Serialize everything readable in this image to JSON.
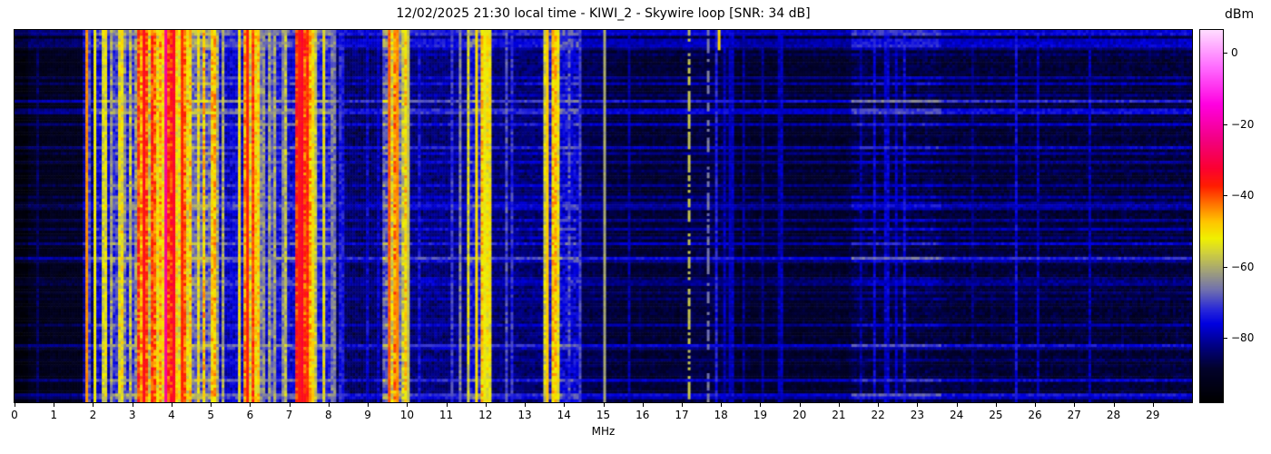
{
  "title": "12/02/2025 21:30 local time - KIWI_2 - Skywire loop [SNR: 34 dB]",
  "station": "KIWI_2",
  "antenna": "Skywire loop",
  "snr_label": "SNR: 34 dB",
  "datetime_local": "12/02/2025 21:30",
  "chart_data": {
    "type": "heatmap",
    "subtype": "radio-spectrum-waterfall",
    "title": "12/02/2025 21:30 local time - KIWI_2 - Skywire loop [SNR: 34 dB]",
    "xlabel": "MHz",
    "x_range": [
      0,
      30
    ],
    "x_tick_values": [
      0,
      1,
      2,
      3,
      4,
      5,
      6,
      7,
      8,
      9,
      10,
      11,
      12,
      13,
      14,
      15,
      16,
      17,
      18,
      19,
      20,
      21,
      22,
      23,
      24,
      25,
      26,
      27,
      28,
      29
    ],
    "y_axis": {
      "type": "time",
      "tick_labels": [],
      "grid": false
    },
    "colorbar": {
      "label": "dBm",
      "ticks": [
        0,
        -20,
        -40,
        -60,
        -80
      ],
      "vmax": 6.4,
      "vmin": -98.1
    },
    "colormap": [
      [
        0.0,
        "#000000"
      ],
      [
        0.09,
        "#02022c"
      ],
      [
        0.155,
        "#00008a"
      ],
      [
        0.21,
        "#0000e0"
      ],
      [
        0.25,
        "#2a2ad8"
      ],
      [
        0.3,
        "#6f6fb0"
      ],
      [
        0.35,
        "#a0a07a"
      ],
      [
        0.4,
        "#cfcf3e"
      ],
      [
        0.44,
        "#f0f000"
      ],
      [
        0.485,
        "#ffc400"
      ],
      [
        0.53,
        "#ff7700"
      ],
      [
        0.58,
        "#ff1e00"
      ],
      [
        0.63,
        "#fb0033"
      ],
      [
        0.7,
        "#f2007c"
      ],
      [
        0.8,
        "#ff00e0"
      ],
      [
        0.9,
        "#ff6bff"
      ],
      [
        1.0,
        "#ffdcff"
      ]
    ],
    "noise_floor_dbm": -93,
    "bands_key": "f=[MHz range], base=background dBm, sd=stripe density 0-1, s=[stripe dBm range], gd=gap density, n=speckle dB, rg=row-noise gain",
    "bands": [
      {
        "f": [
          0.0,
          0.35
        ],
        "base": -96,
        "sd": 0.05,
        "s": [
          -90,
          -84
        ],
        "gd": 0.0,
        "n": 2.0,
        "rg": 1.0
      },
      {
        "f": [
          0.35,
          1.75
        ],
        "base": -93,
        "sd": 0.1,
        "s": [
          -86,
          -78
        ],
        "gd": 0.0,
        "n": 2.5,
        "rg": 1.0
      },
      {
        "f": [
          1.75,
          2.1
        ],
        "base": -84,
        "sd": 0.4,
        "s": [
          -70,
          -44
        ],
        "gd": 0.1,
        "n": 4.0,
        "rg": 1.0
      },
      {
        "f": [
          2.1,
          2.5
        ],
        "base": -79,
        "sd": 0.55,
        "s": [
          -74,
          -52
        ],
        "gd": 0.2,
        "n": 5.0,
        "rg": 1.0
      },
      {
        "f": [
          2.5,
          3.15
        ],
        "base": -74,
        "sd": 0.6,
        "s": [
          -66,
          -46
        ],
        "gd": 0.25,
        "n": 6.0,
        "rg": 1.0
      },
      {
        "f": [
          3.15,
          4.5
        ],
        "base": -60,
        "sd": 0.8,
        "s": [
          -55,
          -37
        ],
        "gd": 0.22,
        "n": 6.0,
        "rg": 1.0
      },
      {
        "f": [
          4.5,
          5.15
        ],
        "base": -70,
        "sd": 0.6,
        "s": [
          -62,
          -44
        ],
        "gd": 0.3,
        "n": 6.0,
        "rg": 1.0
      },
      {
        "f": [
          5.15,
          5.85
        ],
        "base": -79,
        "sd": 0.45,
        "s": [
          -70,
          -52
        ],
        "gd": 0.2,
        "n": 5.0,
        "rg": 1.0
      },
      {
        "f": [
          5.85,
          6.25
        ],
        "base": -62,
        "sd": 0.8,
        "s": [
          -56,
          -40
        ],
        "gd": 0.18,
        "n": 6.0,
        "rg": 1.0
      },
      {
        "f": [
          6.25,
          7.15
        ],
        "base": -78,
        "sd": 0.45,
        "s": [
          -70,
          -50
        ],
        "gd": 0.2,
        "n": 5.0,
        "rg": 1.0
      },
      {
        "f": [
          7.15,
          7.6
        ],
        "base": -60,
        "sd": 0.85,
        "s": [
          -54,
          -36
        ],
        "gd": 0.15,
        "n": 6.0,
        "rg": 1.0
      },
      {
        "f": [
          7.6,
          8.2
        ],
        "base": -76,
        "sd": 0.5,
        "s": [
          -69,
          -50
        ],
        "gd": 0.25,
        "n": 5.0,
        "rg": 1.0
      },
      {
        "f": [
          8.2,
          9.35
        ],
        "base": -86,
        "sd": 0.25,
        "s": [
          -79,
          -62
        ],
        "gd": 0.1,
        "n": 4.0,
        "rg": 1.0
      },
      {
        "f": [
          9.35,
          10.0
        ],
        "base": -70,
        "sd": 0.75,
        "s": [
          -58,
          -42
        ],
        "gd": 0.18,
        "n": 6.0,
        "rg": 1.0
      },
      {
        "f": [
          10.0,
          11.55
        ],
        "base": -84,
        "sd": 0.22,
        "s": [
          -77,
          -63
        ],
        "gd": 0.1,
        "n": 4.0,
        "rg": 1.1
      },
      {
        "f": [
          11.55,
          12.15
        ],
        "base": -76,
        "sd": 0.55,
        "s": [
          -60,
          -47
        ],
        "gd": 0.2,
        "n": 5.0,
        "rg": 1.0
      },
      {
        "f": [
          12.15,
          13.5
        ],
        "base": -85,
        "sd": 0.18,
        "s": [
          -77,
          -64
        ],
        "gd": 0.1,
        "n": 4.0,
        "rg": 1.1
      },
      {
        "f": [
          13.5,
          13.9
        ],
        "base": -78,
        "sd": 0.55,
        "s": [
          -58,
          -47
        ],
        "gd": 0.2,
        "n": 5.0,
        "rg": 1.0
      },
      {
        "f": [
          13.9,
          14.4
        ],
        "base": -79,
        "sd": 0.45,
        "s": [
          -72,
          -60
        ],
        "gd": 0.15,
        "n": 6.0,
        "rg": 1.0
      },
      {
        "f": [
          14.4,
          15.0
        ],
        "base": -87,
        "sd": 0.12,
        "s": [
          -80,
          -70
        ],
        "gd": 0.05,
        "n": 3.0,
        "rg": 1.0
      },
      {
        "f": [
          15.0,
          17.05
        ],
        "base": -89,
        "sd": 0.1,
        "s": [
          -82,
          -72
        ],
        "gd": 0.05,
        "n": 3.0,
        "rg": 1.1
      },
      {
        "f": [
          17.05,
          18.35
        ],
        "base": -88,
        "sd": 0.15,
        "s": [
          -81,
          -70
        ],
        "gd": 0.05,
        "n": 3.0,
        "rg": 1.1
      },
      {
        "f": [
          18.35,
          21.3
        ],
        "base": -90,
        "sd": 0.08,
        "s": [
          -84,
          -76
        ],
        "gd": 0.05,
        "n": 3.0,
        "rg": 1.1
      },
      {
        "f": [
          21.3,
          23.6
        ],
        "base": -88,
        "sd": 0.1,
        "s": [
          -83,
          -75
        ],
        "gd": 0.05,
        "n": 3.5,
        "rg": 1.6
      },
      {
        "f": [
          23.6,
          30.0
        ],
        "base": -89,
        "sd": 0.09,
        "s": [
          -84,
          -76
        ],
        "gd": 0.05,
        "n": 3.5,
        "rg": 1.25
      }
    ],
    "carriers_key": "f=MHz, level=dBm; dashed=intermittent; rows=[start,end) of 128 time rows",
    "carriers": [
      {
        "f": 1.87,
        "level": -44
      },
      {
        "f": 2.02,
        "level": -52
      },
      {
        "f": 3.3,
        "level": -35
      },
      {
        "f": 3.87,
        "level": -22
      },
      {
        "f": 4.07,
        "level": -33
      },
      {
        "f": 4.28,
        "level": -38
      },
      {
        "f": 5.96,
        "level": -37
      },
      {
        "f": 6.07,
        "level": -41
      },
      {
        "f": 7.23,
        "level": -36
      },
      {
        "f": 7.36,
        "level": -33
      },
      {
        "f": 7.49,
        "level": -39
      },
      {
        "f": 9.53,
        "level": -41
      },
      {
        "f": 9.77,
        "level": -44
      },
      {
        "f": 10.0,
        "level": -58
      },
      {
        "f": 11.76,
        "level": -50
      },
      {
        "f": 11.96,
        "level": -53
      },
      {
        "f": 13.6,
        "level": -48
      },
      {
        "f": 13.76,
        "level": -51
      },
      {
        "f": 15.03,
        "level": -61
      },
      {
        "f": 17.18,
        "level": -58,
        "dashed": true
      },
      {
        "f": 17.7,
        "level": -66,
        "dashed": true
      },
      {
        "f": 17.92,
        "level": -49,
        "rows": [
          0,
          7
        ]
      },
      {
        "f": 18.25,
        "level": -79
      }
    ],
    "render": {
      "seed": 7,
      "cols": 432,
      "rows": 128,
      "row_line_prob": 0.32,
      "row_line_boost": [
        3,
        14
      ]
    }
  }
}
